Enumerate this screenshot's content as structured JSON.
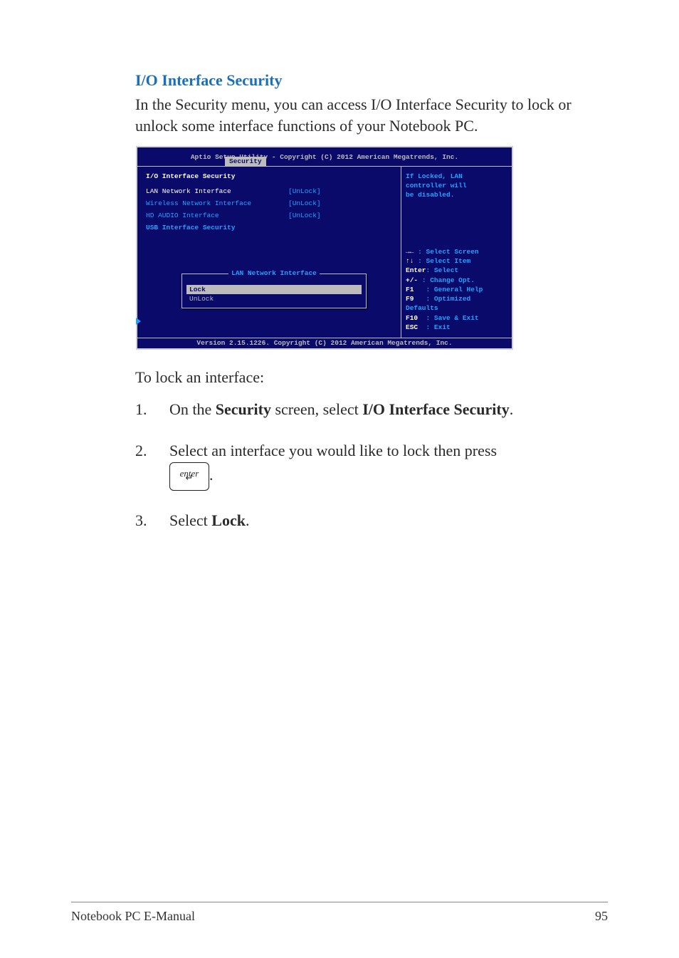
{
  "heading": "I/O Interface Security",
  "intro": "In the Security menu, you can access I/O Interface Security to lock or unlock some interface functions of your Notebook PC.",
  "bios": {
    "titlebar": "Aptio Setup Utility - Copyright (C) 2012 American Megatrends, Inc.",
    "active_tab": "Security",
    "panel_title": "I/O Interface Security",
    "rows": [
      {
        "label": "LAN Network Interface",
        "value": "[UnLock]",
        "selected": true
      },
      {
        "label": "Wireless Network Interface",
        "value": "[UnLock]",
        "selected": false
      },
      {
        "label": "HD AUDIO Interface",
        "value": "[UnLock]",
        "selected": false
      }
    ],
    "submenu_label": "USB Interface Security",
    "popup": {
      "title": "LAN Network Interface",
      "options": [
        "Lock",
        "UnLock"
      ],
      "selected_index": 0
    },
    "help_top_lines": [
      "If Locked, LAN",
      "controller will",
      "be disabled."
    ],
    "help_keys": [
      {
        "key": "→←",
        "desc": ": Select Screen"
      },
      {
        "key": "↑↓",
        "desc": ": Select Item"
      },
      {
        "key": "Enter",
        "desc": ": Select"
      },
      {
        "key": "+/-",
        "desc": ": Change Opt."
      },
      {
        "key": "F1",
        "desc": ": General Help"
      },
      {
        "key": "F9",
        "desc": ": Optimized"
      },
      {
        "key": "",
        "desc": "Defaults"
      },
      {
        "key": "F10",
        "desc": ": Save & Exit"
      },
      {
        "key": "ESC",
        "desc": ": Exit"
      }
    ],
    "footerbar": "Version 2.15.1226. Copyright (C) 2012 American Megatrends, Inc."
  },
  "lead_line": "To lock an interface:",
  "steps": {
    "s1_num": "1.",
    "s1_pre": "On the ",
    "s1_b1": "Security",
    "s1_mid": " screen, select ",
    "s1_b2": "I/O Interface Security",
    "s1_post": ".",
    "s2_num": "2.",
    "s2_text": "Select an interface you would like to lock then press",
    "s2_keycap_top": "enter",
    "s2_keycap_glyph": "↵",
    "s2_post": ".",
    "s3_num": "3.",
    "s3_pre": "Select ",
    "s3_b1": "Lock",
    "s3_post": "."
  },
  "footer": {
    "left": "Notebook PC E-Manual",
    "right": "95"
  }
}
